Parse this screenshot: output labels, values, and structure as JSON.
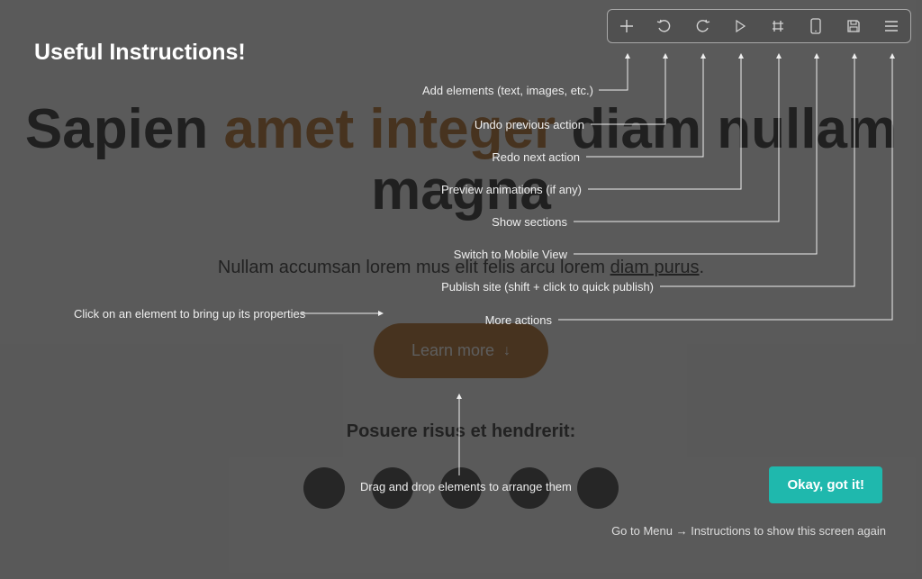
{
  "overlay": {
    "title": "Useful Instructions!",
    "ok_button": "Okay, got it!",
    "footer_note": "Go to Menu → Instructions to show this screen again"
  },
  "toolbar": {
    "items": [
      {
        "name": "add",
        "tip": "Add elements (text, images, etc.)"
      },
      {
        "name": "undo",
        "tip": "Undo previous action"
      },
      {
        "name": "redo",
        "tip": "Redo next action"
      },
      {
        "name": "preview",
        "tip": "Preview animations (if any)"
      },
      {
        "name": "sections",
        "tip": "Show sections"
      },
      {
        "name": "mobile",
        "tip": "Switch to Mobile View"
      },
      {
        "name": "publish",
        "tip": "Publish site (shift + click to quick publish)"
      },
      {
        "name": "menu",
        "tip": "More actions"
      }
    ]
  },
  "hints": {
    "click_element": "Click on an element to bring up its properties",
    "drag_drop": "Drag and drop elements to arrange them"
  },
  "site": {
    "hero_pre": "Sapien ",
    "hero_accent": "amet integer",
    "hero_post": " diam nullam magna",
    "subtitle_pre": "Nullam accumsan lorem mus elit felis arcu lorem ",
    "subtitle_link": "diam purus",
    "subtitle_post": ".",
    "cta_label": "Learn more",
    "trusted_label": "Posuere risus et hendrerit:"
  }
}
